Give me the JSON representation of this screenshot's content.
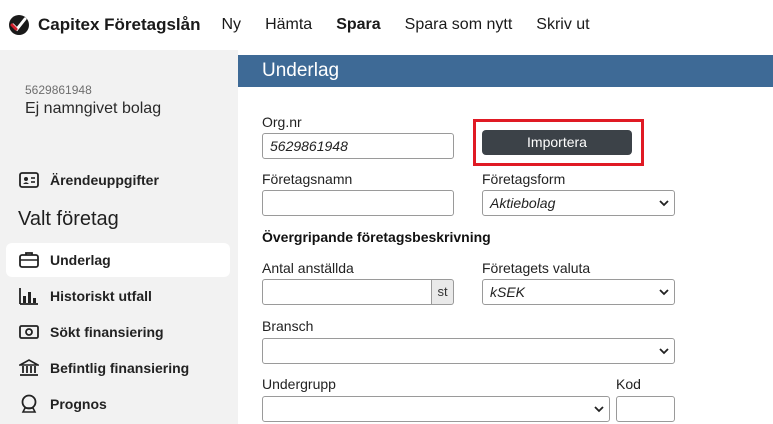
{
  "app": {
    "brand_name": "Capitex Företagslån",
    "menu": [
      "Ny",
      "Hämta",
      "Spara",
      "Spara som nytt",
      "Skriv ut"
    ],
    "active_menu": "Spara"
  },
  "sidebar": {
    "company_id": "5629861948",
    "company_name": "Ej namngivet bolag",
    "top_item": {
      "label": "Ärendeuppgifter",
      "icon": "id-card-icon"
    },
    "section_heading": "Valt företag",
    "items": [
      {
        "label": "Underlag",
        "icon": "briefcase-icon"
      },
      {
        "label": "Historiskt utfall",
        "icon": "bar-chart-icon"
      },
      {
        "label": "Sökt finansiering",
        "icon": "money-icon"
      },
      {
        "label": "Befintlig finansiering",
        "icon": "bank-icon"
      },
      {
        "label": "Prognos",
        "icon": "crystal-ball-icon"
      }
    ],
    "selected": "Underlag"
  },
  "main": {
    "title": "Underlag",
    "orgnr": {
      "label": "Org.nr",
      "value": "5629861948"
    },
    "import_button": "Importera",
    "foretagsnamn": {
      "label": "Företagsnamn",
      "value": ""
    },
    "foretagsform": {
      "label": "Företagsform",
      "value": "Aktiebolag"
    },
    "section_title": "Övergripande företagsbeskrivning",
    "antal_anstallda": {
      "label": "Antal anställda",
      "value": "",
      "suffix": "st"
    },
    "valuta": {
      "label": "Företagets valuta",
      "value": "kSEK"
    },
    "bransch": {
      "label": "Bransch",
      "value": ""
    },
    "undergrupp": {
      "label": "Undergrupp",
      "value": ""
    },
    "kod": {
      "label": "Kod",
      "value": ""
    }
  },
  "colors": {
    "header_bar": "#3e6a96",
    "sidebar_bg": "#f2f2f2",
    "button_bg": "#3c4248",
    "highlight": "#e01a24"
  }
}
